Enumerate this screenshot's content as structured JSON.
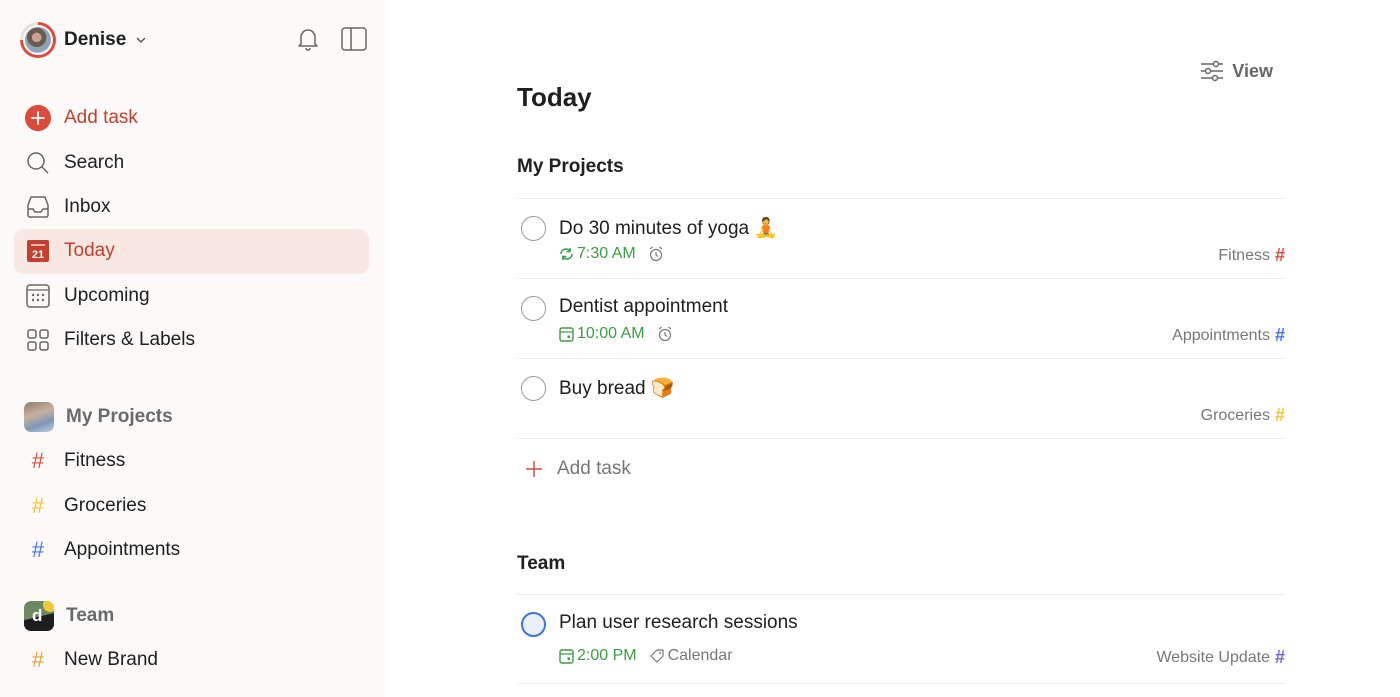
{
  "user": {
    "name": "Denise"
  },
  "sidebar": {
    "nav": [
      {
        "label": "Add task",
        "icon": "plus-circle-icon"
      },
      {
        "label": "Search",
        "icon": "search-icon"
      },
      {
        "label": "Inbox",
        "icon": "inbox-icon"
      },
      {
        "label": "Today",
        "icon": "calendar-today-icon",
        "day": "21",
        "active": true
      },
      {
        "label": "Upcoming",
        "icon": "calendar-grid-icon"
      },
      {
        "label": "Filters & Labels",
        "icon": "grid-icon"
      }
    ],
    "my_projects": {
      "title": "My Projects",
      "items": [
        {
          "name": "Fitness",
          "color": "#dc4c3e"
        },
        {
          "name": "Groceries",
          "color": "#f5c33b"
        },
        {
          "name": "Appointments",
          "color": "#4073ff"
        }
      ]
    },
    "team": {
      "title": "Team",
      "avatar_letter": "d",
      "items": [
        {
          "name": "New Brand",
          "color": "#e8a33d"
        }
      ]
    }
  },
  "main": {
    "view_label": "View",
    "title": "Today",
    "groups": [
      {
        "title": "My Projects",
        "tasks": [
          {
            "title": "Do 30 minutes of yoga",
            "emoji": "🧘",
            "due": "7:30 AM",
            "due_icon": "recurring-icon",
            "reminder": true,
            "project": "Fitness",
            "project_color": "#dc4c3e"
          },
          {
            "title": "Dentist appointment",
            "emoji": "",
            "due": "10:00 AM",
            "due_icon": "calendar-icon",
            "reminder": true,
            "project": "Appointments",
            "project_color": "#4073ff"
          },
          {
            "title": "Buy bread",
            "emoji": "🍞",
            "due": "",
            "project": "Groceries",
            "project_color": "#f5c33b"
          }
        ],
        "add_task_label": "Add task"
      },
      {
        "title": "Team",
        "tasks": [
          {
            "title": "Plan user research sessions",
            "due": "2:00 PM",
            "due_icon": "calendar-icon",
            "label": "Calendar",
            "project": "Website Update",
            "project_color": "#7d5cd6"
          }
        ]
      }
    ]
  },
  "colors": {
    "accent": "#dc4c3e",
    "active_bg": "#f9e8e1",
    "due_green": "#3b9c41",
    "priority_blue": "#4073d6"
  }
}
